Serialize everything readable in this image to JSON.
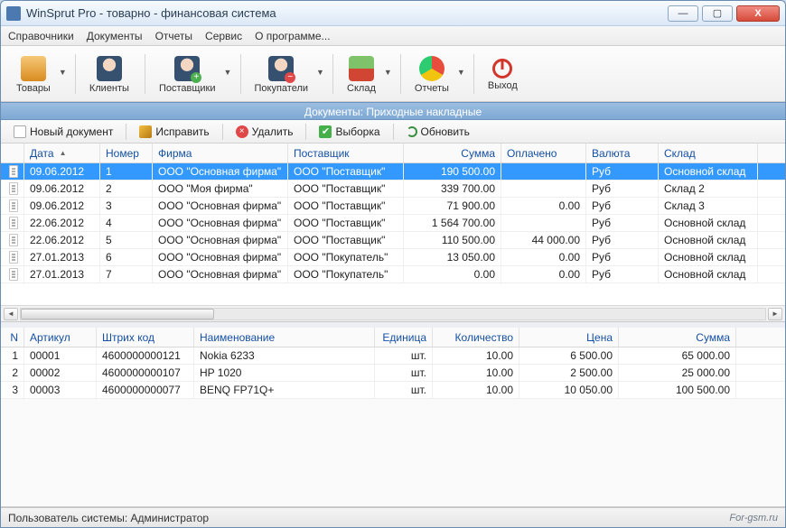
{
  "window": {
    "title": "WinSprut Pro - товарно - финансовая система"
  },
  "menu": [
    "Справочники",
    "Документы",
    "Отчеты",
    "Сервис",
    "О программе..."
  ],
  "toolbar": [
    {
      "label": "Товары",
      "color": "#e79b2f"
    },
    {
      "label": "Клиенты",
      "color": "#5a7ca5"
    },
    {
      "label": "Поставщики",
      "color": "#6aa852"
    },
    {
      "label": "Покупатели",
      "color": "#c06a8e"
    },
    {
      "label": "Склад",
      "color": "#d04632"
    },
    {
      "label": "Отчеты",
      "color": "#e0b62e"
    },
    {
      "label": "Выход",
      "color": "#d2362b"
    }
  ],
  "docHeader": "Документы: Приходные накладные",
  "actions": {
    "new": "Новый документ",
    "edit": "Исправить",
    "del": "Удалить",
    "filter": "Выборка",
    "refresh": "Обновить"
  },
  "grid": {
    "headers": [
      "",
      "Дата",
      "Номер",
      "Фирма",
      "Поставщик",
      "Сумма",
      "Оплачено",
      "Валюта",
      "Склад"
    ],
    "rows": [
      {
        "date": "09.06.2012",
        "num": "1",
        "firm": "ООО \"Основная фирма\"",
        "sup": "ООО \"Поставщик\"",
        "sum": "190 500.00",
        "paid": "",
        "cur": "Руб",
        "wh": "Основной склад",
        "sel": true
      },
      {
        "date": "09.06.2012",
        "num": "2",
        "firm": "ООО \"Моя фирма\"",
        "sup": "ООО \"Поставщик\"",
        "sum": "339 700.00",
        "paid": "",
        "cur": "Руб",
        "wh": "Склад 2"
      },
      {
        "date": "09.06.2012",
        "num": "3",
        "firm": "ООО \"Основная фирма\"",
        "sup": "ООО \"Поставщик\"",
        "sum": "71 900.00",
        "paid": "0.00",
        "cur": "Руб",
        "wh": "Склад 3"
      },
      {
        "date": "22.06.2012",
        "num": "4",
        "firm": "ООО \"Основная фирма\"",
        "sup": "ООО \"Поставщик\"",
        "sum": "1 564 700.00",
        "paid": "",
        "cur": "Руб",
        "wh": "Основной склад"
      },
      {
        "date": "22.06.2012",
        "num": "5",
        "firm": "ООО \"Основная фирма\"",
        "sup": "ООО \"Поставщик\"",
        "sum": "110 500.00",
        "paid": "44 000.00",
        "cur": "Руб",
        "wh": "Основной склад"
      },
      {
        "date": "27.01.2013",
        "num": "6",
        "firm": "ООО \"Основная фирма\"",
        "sup": "ООО \"Покупатель\"",
        "sum": "13 050.00",
        "paid": "0.00",
        "cur": "Руб",
        "wh": "Основной склад"
      },
      {
        "date": "27.01.2013",
        "num": "7",
        "firm": "ООО \"Основная фирма\"",
        "sup": "ООО \"Покупатель\"",
        "sum": "0.00",
        "paid": "0.00",
        "cur": "Руб",
        "wh": "Основной склад"
      }
    ]
  },
  "detail": {
    "headers": [
      "N",
      "Артикул",
      "Штрих код",
      "Наименование",
      "Единица",
      "Количество",
      "Цена",
      "Сумма"
    ],
    "rows": [
      {
        "n": "1",
        "art": "00001",
        "bar": "4600000000121",
        "name": "Nokia 6233",
        "unit": "шт.",
        "qty": "10.00",
        "price": "6 500.00",
        "sum": "65 000.00"
      },
      {
        "n": "2",
        "art": "00002",
        "bar": "4600000000107",
        "name": "HP 1020",
        "unit": "шт.",
        "qty": "10.00",
        "price": "2 500.00",
        "sum": "25 000.00"
      },
      {
        "n": "3",
        "art": "00003",
        "bar": "4600000000077",
        "name": "BENQ FP71Q+",
        "unit": "шт.",
        "qty": "10.00",
        "price": "10 050.00",
        "sum": "100 500.00"
      }
    ]
  },
  "status": {
    "user_label": "Пользователь системы:",
    "user": "Администратор",
    "watermark": "For-gsm.ru"
  }
}
